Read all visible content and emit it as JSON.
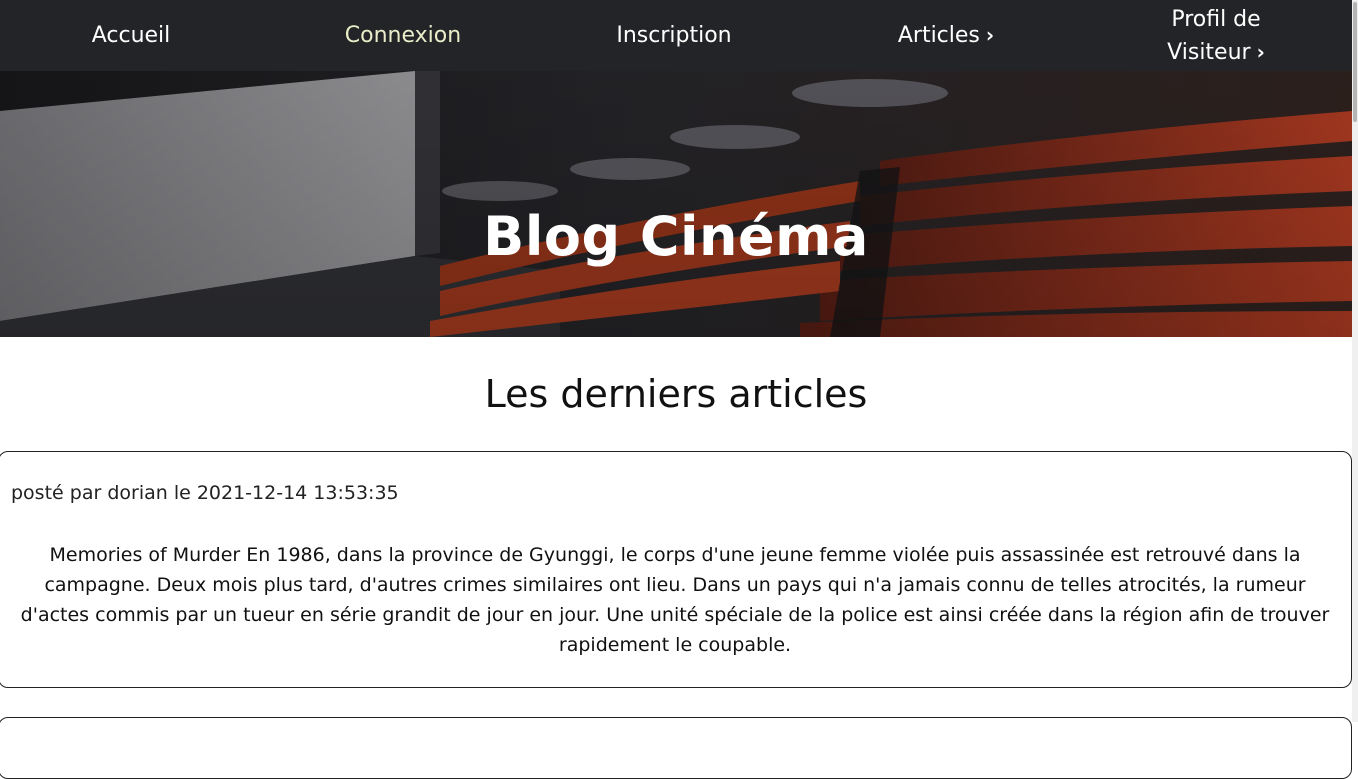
{
  "nav": {
    "items": [
      {
        "label": "Accueil"
      },
      {
        "label": "Connexion"
      },
      {
        "label": "Inscription"
      },
      {
        "label": "Articles",
        "chevron": "›"
      },
      {
        "label_line1": "Profil de",
        "label_line2": "Visiteur",
        "chevron": "›"
      }
    ],
    "active_index": 1,
    "colors": {
      "background": "#232427",
      "text": "#ffffff",
      "active": "#e9edc8"
    }
  },
  "hero": {
    "title": "Blog Cinéma",
    "image": "cinema-theater-seats"
  },
  "main": {
    "section_title": "Les derniers articles",
    "articles": [
      {
        "meta": "posté par dorian le 2021-12-14 13:53:35",
        "body": "Memories of Murder En 1986, dans la province de Gyunggi, le corps d'une jeune femme violée puis assassinée est retrouvé dans la campagne. Deux mois plus tard, d'autres crimes similaires ont lieu. Dans un pays qui n'a jamais connu de telles atrocités, la rumeur d'actes commis par un tueur en série grandit de jour en jour. Une unité spéciale de la police est ainsi créée dans la région afin de trouver rapidement le coupable."
      }
    ]
  }
}
